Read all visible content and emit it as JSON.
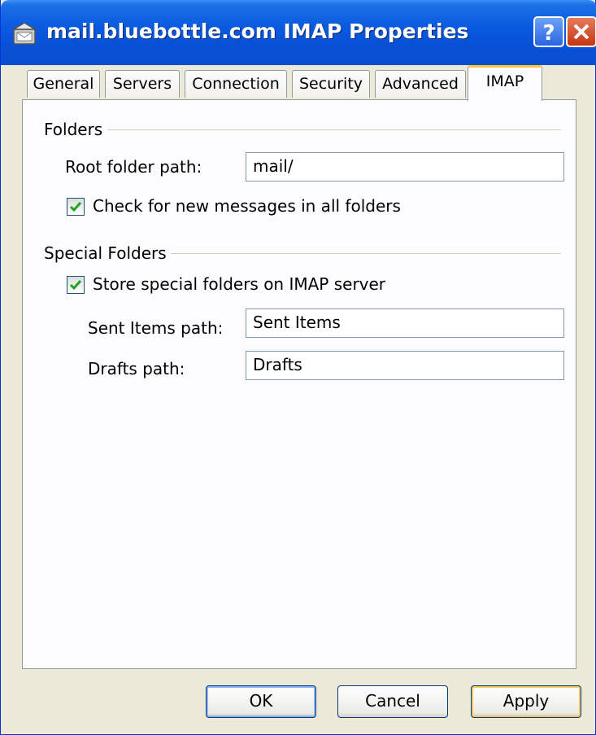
{
  "window": {
    "title": "mail.bluebottle.com IMAP Properties",
    "icon": "mail-server-icon"
  },
  "tabs": [
    {
      "label": "General"
    },
    {
      "label": "Servers"
    },
    {
      "label": "Connection"
    },
    {
      "label": "Security"
    },
    {
      "label": "Advanced"
    },
    {
      "label": "IMAP",
      "active": true
    }
  ],
  "folders": {
    "group_label": "Folders",
    "root_path_label": "Root folder path:",
    "root_path_value": "mail/",
    "check_all_label": "Check for new messages in all folders",
    "check_all_checked": true
  },
  "special": {
    "group_label": "Special Folders",
    "store_label": "Store special folders on IMAP server",
    "store_checked": true,
    "sent_label": "Sent Items path:",
    "sent_value": "Sent Items",
    "drafts_label": "Drafts path:",
    "drafts_value": "Drafts"
  },
  "buttons": {
    "ok": "OK",
    "cancel": "Cancel",
    "apply": "Apply"
  },
  "colors": {
    "titlebar": "#0a5be0",
    "active_tab_accent": "#ffc83c",
    "checkmark": "#21a121"
  }
}
